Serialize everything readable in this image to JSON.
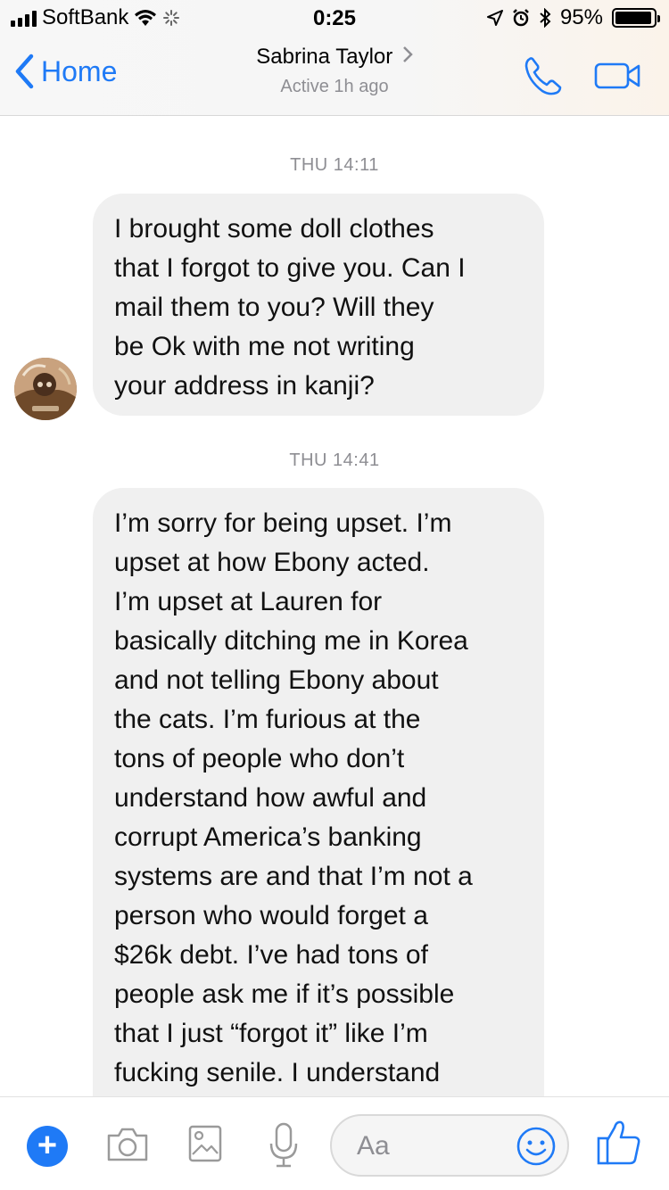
{
  "status_bar": {
    "carrier": "SoftBank",
    "time": "0:25",
    "battery_percent": "95%",
    "battery_level": 0.95
  },
  "header": {
    "back_label": "Home",
    "contact_name": "Sabrina Taylor",
    "presence": "Active 1h ago",
    "accent_color": "#1f7af6"
  },
  "messages": [
    {
      "timestamp": "THU 14:11",
      "text": "I brought some doll clothes\nthat I forgot to give you.  Can I\nmail them to you?  Will they\nbe Ok with me not writing\nyour address in kanji?"
    },
    {
      "timestamp": "THU 14:41",
      "text": "I’m sorry for being upset.  I’m\nupset at how Ebony acted.\nI’m upset at Lauren for\nbasically ditching me in Korea\nand not telling Ebony about\nthe cats.  I’m furious at the\ntons of people who don’t\nunderstand how awful and\ncorrupt America’s banking\nsystems are and that I’m not a\nperson who would forget a\n$26k debt.   I’ve had tons of\npeople ask me if it’s possible\nthat I just “forgot it” like I’m\nfucking senile.   I understand"
    }
  ],
  "composer": {
    "placeholder": "Aa",
    "icons": [
      "plus-icon",
      "camera-icon",
      "photo-icon",
      "microphone-icon",
      "emoji-icon",
      "thumbs-up-icon"
    ]
  }
}
